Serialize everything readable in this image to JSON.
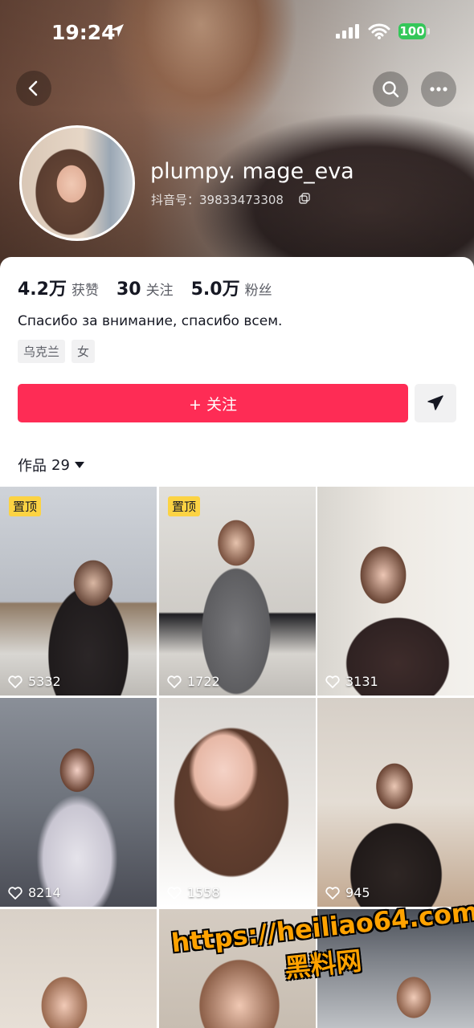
{
  "status_bar": {
    "time": "19:24",
    "battery": "100"
  },
  "profile": {
    "username": "plumpy. mage_eva",
    "douyin_id": "抖音号：39833473308",
    "stats": [
      {
        "value": "4.2万",
        "label": "获赞"
      },
      {
        "value": "30",
        "label": "关注"
      },
      {
        "value": "5.0万",
        "label": "粉丝"
      }
    ],
    "bio": "Спасибо за внимание, спасибо всем.",
    "tags": [
      "乌克兰",
      "女"
    ]
  },
  "actions": {
    "follow_label": "+ 关注"
  },
  "works": {
    "label": "作品",
    "count": "29"
  },
  "videos": [
    {
      "pinned": "置顶",
      "likes": "5332"
    },
    {
      "pinned": "置顶",
      "likes": "1722"
    },
    {
      "pinned": "",
      "likes": "3131"
    },
    {
      "pinned": "",
      "likes": "8214"
    },
    {
      "pinned": "",
      "likes": "1558"
    },
    {
      "pinned": "",
      "likes": "945"
    },
    {
      "pinned": "",
      "likes": ""
    },
    {
      "pinned": "",
      "likes": ""
    },
    {
      "pinned": "",
      "likes": ""
    }
  ],
  "watermark": {
    "url": "https://heiliao64.com",
    "text": "黑料网"
  },
  "colors": {
    "accent": "#fe2c55",
    "pin_badge": "#fcd343",
    "battery": "#34c759"
  }
}
